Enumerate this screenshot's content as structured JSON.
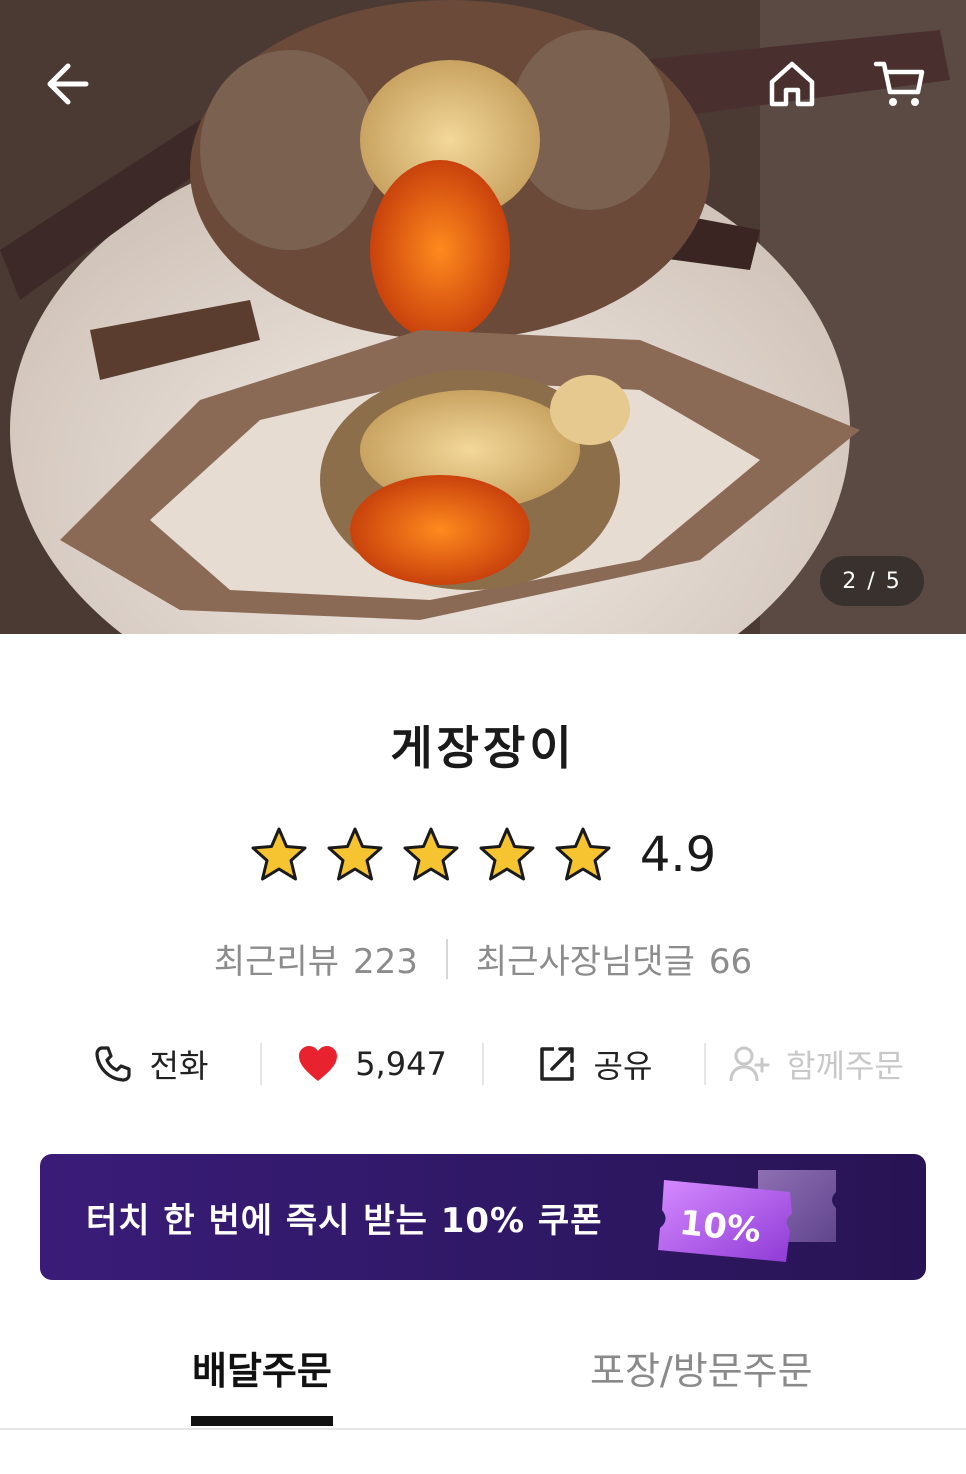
{
  "hero": {
    "counter": "2 / 5",
    "icons": {
      "back": "arrow-left-icon",
      "home": "home-icon",
      "cart": "cart-icon"
    }
  },
  "store": {
    "name": "게장장이",
    "rating": "4.9",
    "rating_stars": 5,
    "reviews_label": "최근리뷰",
    "reviews_count": "223",
    "owner_replies_label": "최근사장님댓글",
    "owner_replies_count": "66"
  },
  "actions": {
    "call": {
      "label": "전화",
      "icon": "phone-icon"
    },
    "like": {
      "label": "5,947",
      "icon": "heart-icon"
    },
    "share": {
      "label": "공유",
      "icon": "share-icon"
    },
    "group_order": {
      "label": "함께주문",
      "icon": "add-user-icon"
    }
  },
  "coupon": {
    "text": "터치 한 번에 즉시 받는 10% 쿠폰",
    "badge": "10%"
  },
  "tabs": {
    "delivery": "배달주문",
    "pickup": "포장/방문주문"
  },
  "colors": {
    "coupon_bg": "#2f1865",
    "star": "#f6c431",
    "heart": "#e8232f",
    "coupon_ticket": "#b558f0"
  }
}
